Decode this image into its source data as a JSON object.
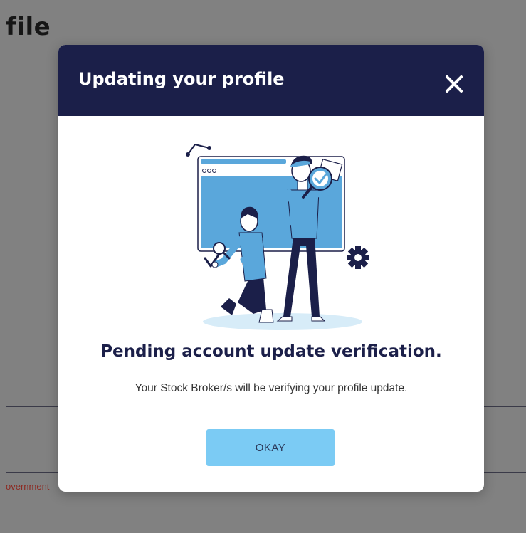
{
  "background": {
    "page_title_fragment": "file",
    "error_fragment": "overnment"
  },
  "modal": {
    "title": "Updating your profile",
    "close_icon": "close-icon",
    "heading": "Pending account update verification.",
    "message": "Your Stock Broker/s will be verifying your profile update.",
    "okay_label": "OKAY"
  },
  "colors": {
    "overlay": "#818181",
    "header_bg": "#1b1f49",
    "heading_text": "#1b1f49",
    "button_bg": "#7bcbf4",
    "illustration_accent": "#5aa7db"
  }
}
